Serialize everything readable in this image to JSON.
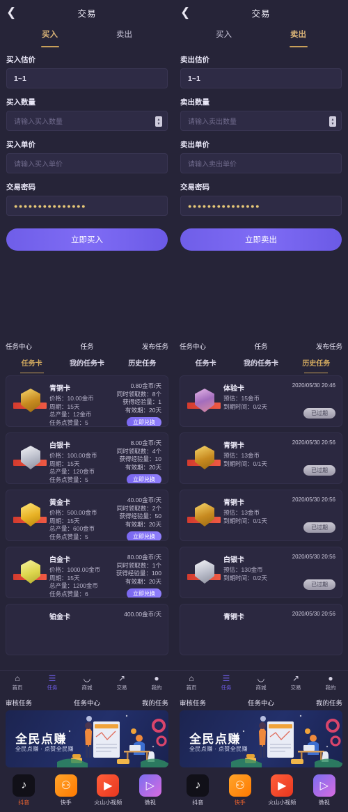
{
  "trade": {
    "left": {
      "back_icon": "❮",
      "title": "交易",
      "tabs": [
        {
          "label": "买入",
          "active": true
        },
        {
          "label": "卖出",
          "active": false
        }
      ],
      "fields": [
        {
          "label": "买入估价",
          "value": "1~1",
          "placeholder": "",
          "type": "value"
        },
        {
          "label": "买入数量",
          "value": "",
          "placeholder": "请输入买入数量",
          "type": "stepper"
        },
        {
          "label": "买入单价",
          "value": "",
          "placeholder": "请输入买入单价",
          "type": "text"
        },
        {
          "label": "交易密码",
          "value": "●●●●●●●●●●●●●●●",
          "placeholder": "",
          "type": "password"
        }
      ],
      "submit_label": "立即买入"
    },
    "right": {
      "back_icon": "❮",
      "title": "交易",
      "tabs": [
        {
          "label": "买入",
          "active": false
        },
        {
          "label": "卖出",
          "active": true
        }
      ],
      "fields": [
        {
          "label": "卖出估价",
          "value": "1~1",
          "placeholder": "",
          "type": "value"
        },
        {
          "label": "卖出数量",
          "value": "",
          "placeholder": "请输入卖出数量",
          "type": "stepper"
        },
        {
          "label": "卖出单价",
          "value": "",
          "placeholder": "请输入卖出单价",
          "type": "text"
        },
        {
          "label": "交易密码",
          "value": "●●●●●●●●●●●●●●●",
          "placeholder": "",
          "type": "password"
        }
      ],
      "submit_label": "立即卖出"
    }
  },
  "task": {
    "header": {
      "left": "任务中心",
      "center": "任务",
      "right": "发布任务"
    },
    "tabs": [
      {
        "label": "任务卡"
      },
      {
        "label": "我的任务卡"
      },
      {
        "label": "历史任务"
      }
    ],
    "left_active_tab": 0,
    "right_active_tab": 2,
    "cards": [
      {
        "name": "青铜卡",
        "badge": "bronze",
        "price": "价格：10.00金币",
        "cycle": "周期：15天",
        "total": "总产量：12金币",
        "points": "任务点赞量：5",
        "rate": "0.80金币/天",
        "concurrent": "同时领取数：8个",
        "exp": "获得经验量：1",
        "valid": "有效期：20天",
        "button": "立即兑换"
      },
      {
        "name": "白银卡",
        "badge": "silver",
        "price": "价格：100.00金币",
        "cycle": "周期：15天",
        "total": "总产量：120金币",
        "points": "任务点赞量：5",
        "rate": "8.00金币/天",
        "concurrent": "同时领取数：4个",
        "exp": "获得经验量：10",
        "valid": "有效期：20天",
        "button": "立即兑换"
      },
      {
        "name": "黄金卡",
        "badge": "gold",
        "price": "价格：500.00金币",
        "cycle": "周期：15天",
        "total": "总产量：600金币",
        "points": "任务点赞量：5",
        "rate": "40.00金币/天",
        "concurrent": "同时领取数：2个",
        "exp": "获得经验量：50",
        "valid": "有效期：20天",
        "button": "立即兑换"
      },
      {
        "name": "白金卡",
        "badge": "platinum",
        "price": "价格：1000.00金币",
        "cycle": "周期：15天",
        "total": "总产量：1200金币",
        "points": "任务点赞量：6",
        "rate": "80.00金币/天",
        "concurrent": "同时领取数：1个",
        "exp": "获得经验量：100",
        "valid": "有效期：20天",
        "button": "立即兑换"
      },
      {
        "name": "铂金卡",
        "badge": "platinum",
        "price": "",
        "cycle": "",
        "total": "",
        "points": "",
        "rate": "400.00金币/天",
        "concurrent": "",
        "exp": "",
        "valid": "",
        "button": ""
      }
    ],
    "history": [
      {
        "name": "体验卡",
        "badge": "trial",
        "date": "2020/05/30 20:46",
        "estimate": "预估：15金币",
        "expiry": "到期时间：0/2天",
        "status": "已过期"
      },
      {
        "name": "青铜卡",
        "badge": "bronze",
        "date": "2020/05/30 20:56",
        "estimate": "预估：13金币",
        "expiry": "到期时间：0/1天",
        "status": "已过期"
      },
      {
        "name": "青铜卡",
        "badge": "bronze",
        "date": "2020/05/30 20:56",
        "estimate": "预估：13金币",
        "expiry": "到期时间：0/1天",
        "status": "已过期"
      },
      {
        "name": "白银卡",
        "badge": "silver",
        "date": "2020/05/30 20:56",
        "estimate": "预估：130金币",
        "expiry": "到期时间：0/2天",
        "status": "已过期"
      },
      {
        "name": "青铜卡",
        "badge": "bronze",
        "date": "2020/05/30 20:56",
        "estimate": "",
        "expiry": "",
        "status": ""
      }
    ]
  },
  "bottom_nav": {
    "items": [
      {
        "label": "首页",
        "icon": "⌂",
        "icon_name": "home-icon"
      },
      {
        "label": "任务",
        "icon": "☰",
        "icon_name": "task-icon"
      },
      {
        "label": "商城",
        "icon": "◡",
        "icon_name": "shop-icon"
      },
      {
        "label": "交易",
        "icon": "↗",
        "icon_name": "trade-icon"
      },
      {
        "label": "我的",
        "icon": "●",
        "icon_name": "profile-icon"
      }
    ],
    "active_index": 1
  },
  "footer": {
    "header": {
      "left": "审核任务",
      "center": "任务中心",
      "right": "我的任务"
    },
    "banner": {
      "title": "全民点赚",
      "subtitle": "全民点赚 · 点赞全民赚"
    },
    "apps": [
      {
        "label": "抖音",
        "icon": "♪",
        "icon_name": "douyin-icon",
        "cls": "ic-douyin"
      },
      {
        "label": "快手",
        "icon": "⚇",
        "icon_name": "kuaishou-icon",
        "cls": "ic-kuaishou"
      },
      {
        "label": "火山小视频",
        "icon": "▶",
        "icon_name": "huoshan-icon",
        "cls": "ic-huoshan"
      },
      {
        "label": "微视",
        "icon": "▷",
        "icon_name": "weishi-icon",
        "cls": "ic-weishi"
      }
    ],
    "left_active_app": 0,
    "right_active_app": 1
  },
  "colors": {
    "background": "#262438",
    "card": "#2b2840",
    "accent_purple": "#6f5ee8",
    "accent_gold": "#c8a05a",
    "banner_bg": "#1c2450",
    "active_app": "#e8622f"
  }
}
